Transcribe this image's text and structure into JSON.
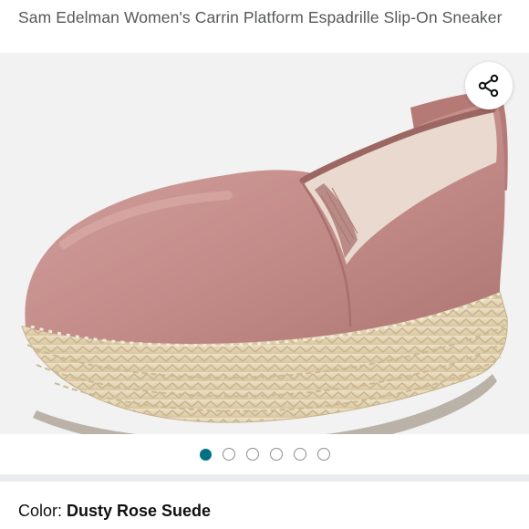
{
  "product": {
    "title": "Sam Edelman Women's Carrin Platform Espadrille Slip-On Sneaker"
  },
  "gallery": {
    "share_icon": "share-icon",
    "image_count": 6,
    "active_index": 0
  },
  "variation": {
    "color_label": "Color: ",
    "color_value": "Dusty Rose Suede"
  },
  "colors": {
    "accent": "#007185",
    "suede": "#c99593",
    "jute": "#e3d4b4"
  }
}
